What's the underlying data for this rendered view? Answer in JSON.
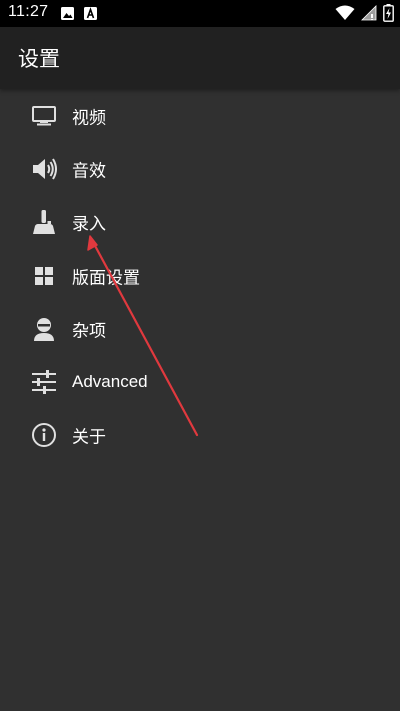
{
  "status_bar": {
    "time": "11:27",
    "left_icons": [
      "image-icon",
      "text-a-icon"
    ],
    "right_icons": [
      "wifi-icon",
      "signal-icon",
      "battery-charging-icon"
    ]
  },
  "app_bar": {
    "title": "设置"
  },
  "menu": {
    "items": [
      {
        "label": "视频",
        "icon": "monitor-icon"
      },
      {
        "label": "音效",
        "icon": "speaker-icon"
      },
      {
        "label": "录入",
        "icon": "joystick-icon"
      },
      {
        "label": "版面设置",
        "icon": "grid-icon"
      },
      {
        "label": "杂项",
        "icon": "person-icon"
      },
      {
        "label": "Advanced",
        "icon": "sliders-icon"
      },
      {
        "label": "关于",
        "icon": "info-icon"
      }
    ]
  },
  "colors": {
    "background": "#303030",
    "app_bar": "#212121",
    "status_bar": "#000000",
    "text": "#ffffff",
    "icon": "#e0e0e0",
    "annotation_arrow": "#e0393e"
  }
}
